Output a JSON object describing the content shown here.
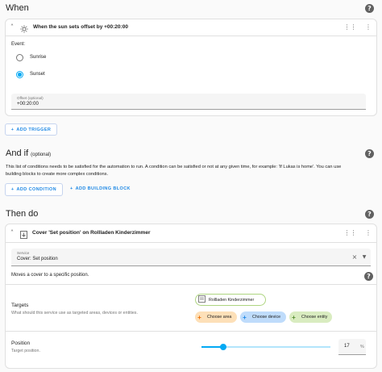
{
  "when": {
    "title": "When",
    "trigger": {
      "header": "When the sun sets offset by +00:20:00",
      "event_label": "Event:",
      "options": [
        "Sunrise",
        "Sunset"
      ],
      "selected": "Sunset",
      "offset_label": "Offset (optional)",
      "offset_value": "+00:20:00"
    },
    "add_trigger": "ADD TRIGGER"
  },
  "and_if": {
    "title": "And if",
    "optional": "(optional)",
    "description_line1": "This list of conditions needs to be satisfied for the automation to run. A condition can be satisfied or not at any given time, for example: 'If Lukas is home'. You can use",
    "description_line2": "building blocks to create more complex conditions.",
    "add_condition": "ADD CONDITION",
    "add_building_block": "ADD BUILDING BLOCK"
  },
  "then_do": {
    "title": "Then do",
    "action": {
      "header": "Cover 'Set position' on Rollladen Kinderzimmer",
      "service_label": "Service",
      "service_value": "Cover: Set position",
      "description": "Moves a cover to a specific position.",
      "targets_label": "Targets",
      "targets_desc": "What should this service use as targeted areas, devices or entities.",
      "target_chip": "Rollladen Kinderzimmer",
      "choose_area": "Choose area",
      "choose_device": "Choose device",
      "choose_entity": "Choose entity",
      "position_label": "Position",
      "position_desc": "Target position.",
      "position_value": "17",
      "position_unit": "%",
      "position_fraction": 0.17
    }
  },
  "colors": {
    "accent": "#03a9f4",
    "link": "#1e88e5",
    "area_chip": "#fde0b8",
    "device_chip": "#bfdcfb",
    "entity_chip": "#d9ecc0"
  }
}
